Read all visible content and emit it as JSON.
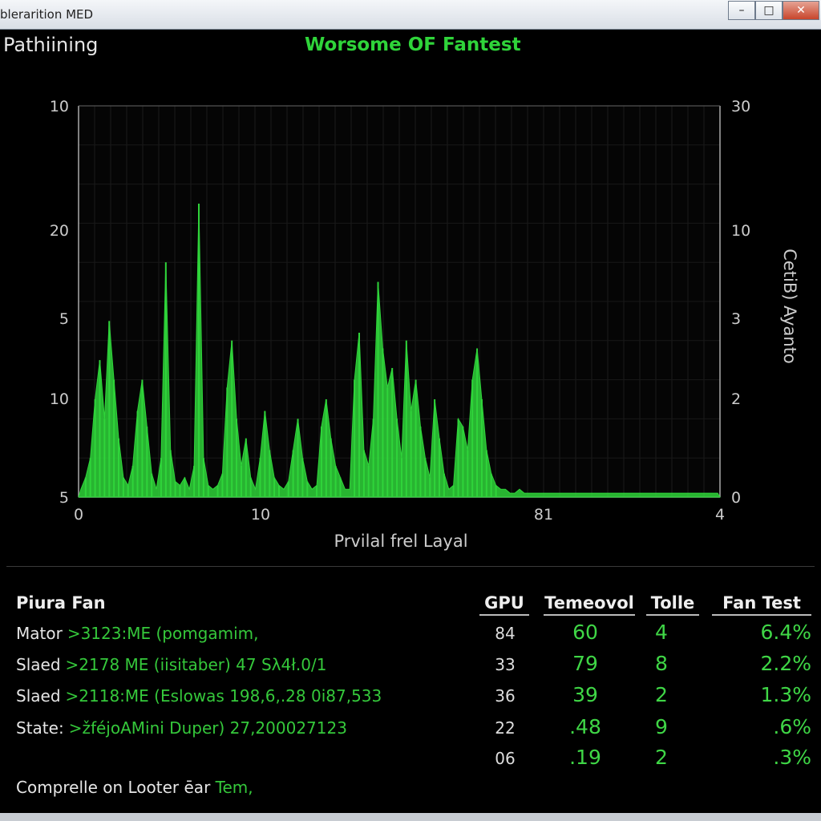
{
  "window": {
    "title": "blerarition MED",
    "minimize_label": "–",
    "maximize_label": "□",
    "close_label": "✕"
  },
  "app_label": "Pathiining",
  "chart_title": "Worsome OF Fantest",
  "chart_data": {
    "type": "area",
    "title": "Worsome OF Fantest",
    "xlabel": "Prvilal frel Layal",
    "ylabel_right": "CetiB) Ayanto",
    "x_ticks": [
      "0",
      "10",
      "81",
      "4"
    ],
    "y_ticks_left": [
      "10",
      "20",
      "5",
      "10",
      "5"
    ],
    "y_ticks_right": [
      "30",
      "10",
      "3",
      "2",
      "0"
    ],
    "grid": true,
    "color": "#2fd43a",
    "series": [
      {
        "values": [
          0.02,
          0.05,
          0.1,
          0.25,
          0.35,
          0.2,
          0.45,
          0.3,
          0.15,
          0.05,
          0.03,
          0.08,
          0.22,
          0.3,
          0.18,
          0.06,
          0.02,
          0.1,
          0.6,
          0.12,
          0.04,
          0.03,
          0.05,
          0.02,
          0.08,
          0.75,
          0.1,
          0.03,
          0.02,
          0.03,
          0.06,
          0.28,
          0.4,
          0.2,
          0.08,
          0.15,
          0.05,
          0.02,
          0.1,
          0.22,
          0.12,
          0.05,
          0.03,
          0.02,
          0.04,
          0.12,
          0.2,
          0.1,
          0.04,
          0.02,
          0.03,
          0.18,
          0.25,
          0.15,
          0.08,
          0.05,
          0.02,
          0.02,
          0.3,
          0.42,
          0.12,
          0.08,
          0.2,
          0.55,
          0.38,
          0.28,
          0.33,
          0.2,
          0.1,
          0.4,
          0.22,
          0.3,
          0.18,
          0.1,
          0.05,
          0.25,
          0.15,
          0.06,
          0.02,
          0.03,
          0.2,
          0.18,
          0.12,
          0.3,
          0.38,
          0.25,
          0.12,
          0.06,
          0.03,
          0.02,
          0.02,
          0.01,
          0.01,
          0.02,
          0.01,
          0.01,
          0.01,
          0.01,
          0.01,
          0.01,
          0.01,
          0.01,
          0.01,
          0.01,
          0.01,
          0.01,
          0.01,
          0.01,
          0.01,
          0.01,
          0.01,
          0.01,
          0.01,
          0.01,
          0.01,
          0.01,
          0.01,
          0.01,
          0.01,
          0.01,
          0.01,
          0.01,
          0.01,
          0.01,
          0.01,
          0.01,
          0.01,
          0.01,
          0.01,
          0.01,
          0.01,
          0.01,
          0.01,
          0.01,
          0.01,
          0.01
        ]
      }
    ]
  },
  "table": {
    "section_label": "Piura Fan",
    "headers": [
      "GPU",
      "Temeovol",
      "Tolle",
      "Fan Test"
    ],
    "rows": [
      {
        "label": "Mator",
        "desc": ">3123:ME (pomgamim,",
        "gpu": "84",
        "temp": "60",
        "tolle": "4",
        "fan": "6.4%"
      },
      {
        "label": "Slaed",
        "desc": ">2178 ME (iisitaber) 47 Sλ4ł.0/1",
        "gpu": "33",
        "temp": "79",
        "tolle": "8",
        "fan": "2.2%"
      },
      {
        "label": "Slaed",
        "desc": ">2118:ME (Eslowas 198,6,.28 0i87,533",
        "gpu": "36",
        "temp": "39",
        "tolle": "2",
        "fan": "1.3%"
      },
      {
        "label": "State:",
        "desc": ">žféjoAMini Duper)  27,200027123",
        "gpu": "22",
        "temp": ".48",
        "tolle": "9",
        "fan": ".6%"
      },
      {
        "label": "",
        "desc": "",
        "gpu": "06",
        "temp": ".19",
        "tolle": "2",
        "fan": ".3%"
      }
    ]
  },
  "footer": {
    "text": "Comprelle on Looter ēar",
    "accent": "Tem,"
  }
}
